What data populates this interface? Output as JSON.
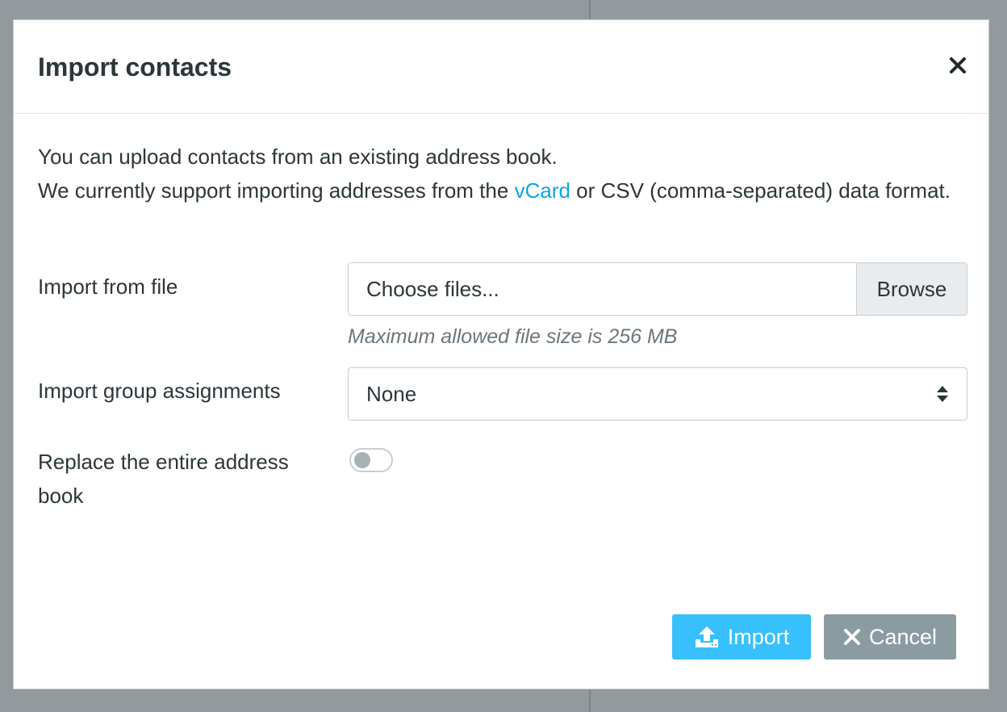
{
  "dialog": {
    "title": "Import contacts",
    "close_icon": "close-icon"
  },
  "intro": {
    "line1": "You can upload contacts from an existing address book.",
    "line2_before": "We currently support importing addresses from the ",
    "line2_link": "vCard",
    "line2_after": " or CSV (comma-separated) data format."
  },
  "form": {
    "file": {
      "label": "Import from file",
      "placeholder": "Choose files...",
      "browse_label": "Browse",
      "hint": "Maximum allowed file size is 256 MB"
    },
    "groups": {
      "label": "Import group assignments",
      "selected": "None",
      "icon": "select-arrows-icon"
    },
    "replace": {
      "label": "Replace the entire address book",
      "enabled": false
    }
  },
  "buttons": {
    "import_label": "Import",
    "import_icon": "upload-icon",
    "cancel_label": "Cancel",
    "cancel_icon": "close-icon"
  },
  "colors": {
    "primary": "#37c0fb",
    "secondary": "#8a9ba2",
    "link": "#0ea4e8"
  }
}
